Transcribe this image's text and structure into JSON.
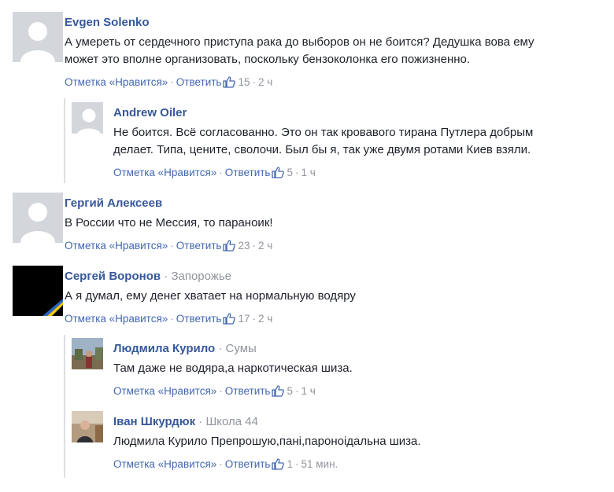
{
  "ui": {
    "like_label": "Отметка «Нравится»",
    "reply_label": "Ответить",
    "sep": "·"
  },
  "comments": [
    {
      "name": "Evgen Solenko",
      "location": "",
      "lines": [
        "А умереть от сердечного приступа рака до выборов он не боится? Дедушка вова ему",
        "может это вполне организовать, поскольку бензоколонка его пожизненно."
      ],
      "likes": "15",
      "time": "2 ч"
    },
    {
      "name": "Andrew Oiler",
      "location": "",
      "lines": [
        "Не боится. Всё согласованно. Это он так кровавого тирана Путлера добрым",
        "делает. Типа, цените, сволочи. Был бы я, так уже двумя ротами Киев взяли."
      ],
      "likes": "5",
      "time": "1 ч"
    },
    {
      "name": "Гергий Алексеев",
      "location": "",
      "lines": [
        "В России что не Мессия, то параноик!"
      ],
      "likes": "23",
      "time": "2 ч"
    },
    {
      "name": "Сергей Воронов",
      "location": "Запорожье",
      "lines": [
        "А я думал, ему денег хватает на нормальную водяру"
      ],
      "likes": "17",
      "time": "2 ч"
    },
    {
      "name": "Людмила Курило",
      "location": "Сумы",
      "lines": [
        "Там даже не водяра,а наркотическая шиза."
      ],
      "likes": "5",
      "time": "1 ч"
    },
    {
      "name": "Іван Шкурдюк",
      "location": "Школа 44",
      "lines": [
        "Людмила Курило Препрошую,пані,пароноідальна шиза."
      ],
      "likes": "1",
      "time": "51 мин."
    }
  ],
  "colors": {
    "name": "#365899",
    "action": "#4267b2",
    "meta": "#90949c",
    "text": "#1d2129",
    "avatar_placeholder": "#d3d6db"
  }
}
